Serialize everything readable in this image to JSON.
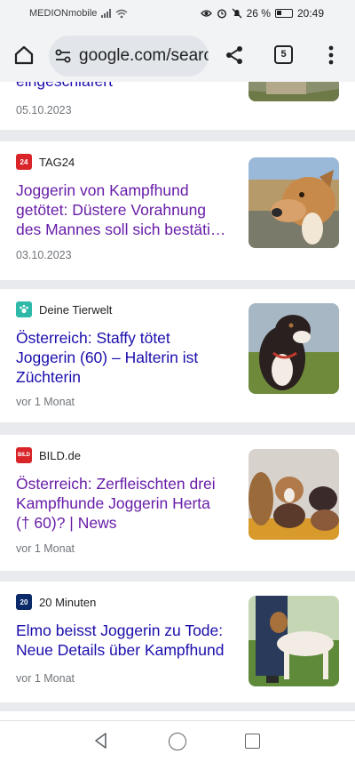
{
  "status_bar": {
    "carrier": "MEDIONmobile",
    "battery": "26 %",
    "time": "20:49"
  },
  "toolbar": {
    "url": "google.com/search",
    "tab_count": "5"
  },
  "results": [
    {
      "title": "eingeschläfert",
      "date": "05.10.2023"
    },
    {
      "source": "TAG24",
      "favicon_text": "24",
      "title_line1": "Joggerin von Kampfhund",
      "title_line2": "getötet: Düstere Vorahnung",
      "title_line3": "des Mannes soll sich bestäti…",
      "date": "03.10.2023"
    },
    {
      "source": "Deine Tierwelt",
      "title_line1": "Österreich: Staffy tötet",
      "title_line2": "Joggerin (60) – Halterin ist",
      "title_line3": "Züchterin",
      "date": "vor 1 Monat"
    },
    {
      "source": "BILD.de",
      "favicon_text": "BILD",
      "title_line1": "Österreich: Zerfleischten drei",
      "title_line2": "Kampfhunde Joggerin Herta",
      "title_line3": "(† 60)? | News",
      "date": "vor 1 Monat"
    },
    {
      "source": "20 Minuten",
      "favicon_text": "20",
      "title_line1": "Elmo beisst Joggerin zu Tode:",
      "title_line2": "Neue Details über Kampfhund",
      "date": "vor 1 Monat"
    }
  ],
  "icons": {
    "home": "home-icon",
    "site_settings": "tune-icon",
    "share": "share-icon",
    "menu": "more-vert-icon",
    "nav_back": "triangle-back-icon",
    "nav_home": "circle-home-icon",
    "nav_recent": "square-recents-icon"
  },
  "colors": {
    "link": "#1a0dab",
    "visited": "#681da8",
    "toolbar_bg": "#f1f3f4",
    "separator": "#e8eaed"
  }
}
